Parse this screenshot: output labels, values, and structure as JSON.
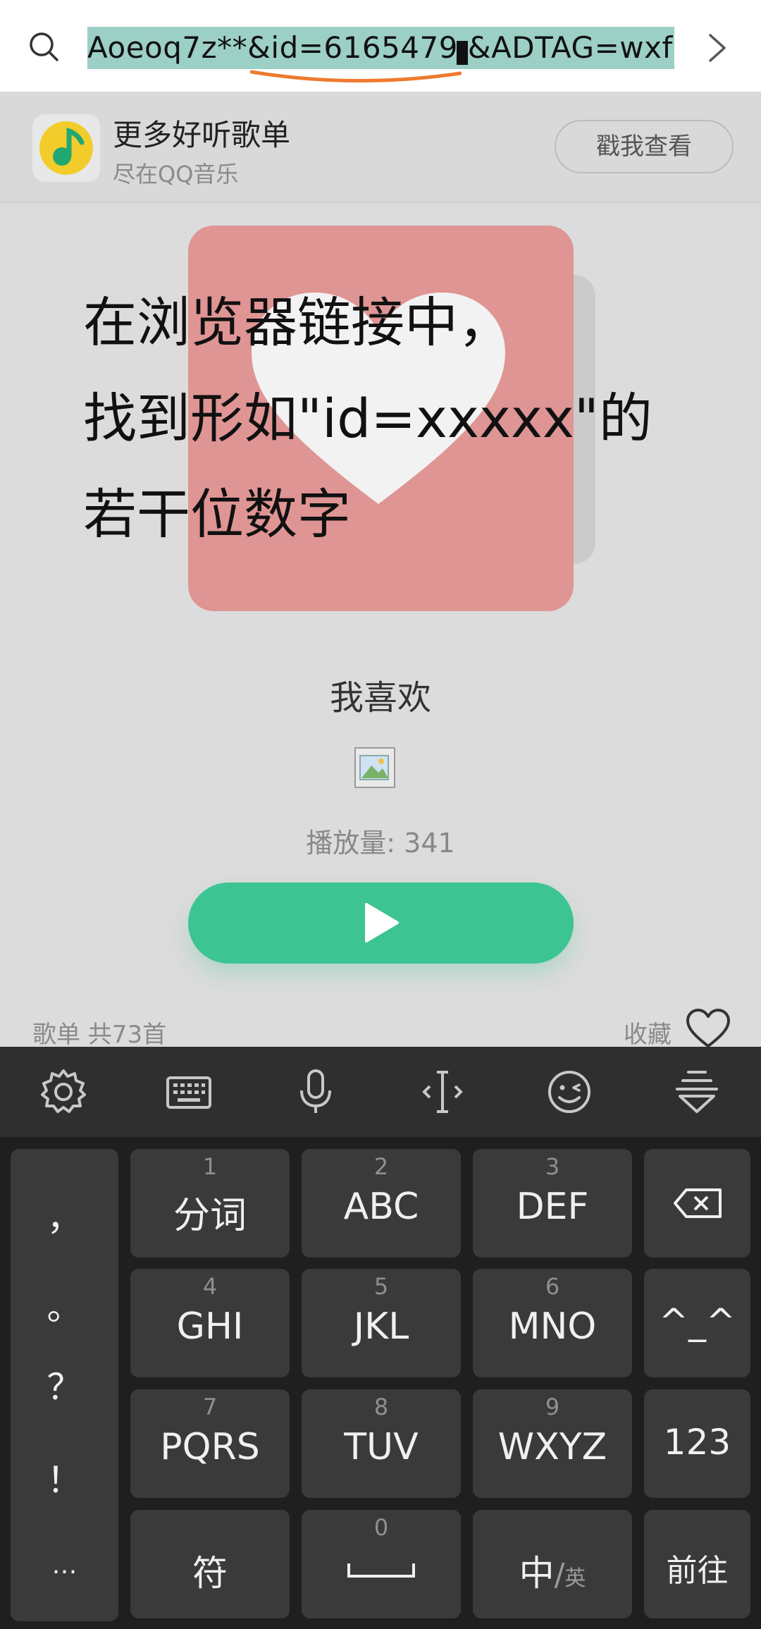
{
  "url_bar": {
    "url_text": "Aoeoq7z**&id=6165479  &ADTAG=wxf",
    "highlight_color": "#9ccfc6",
    "underline_color": "#ef7a2e"
  },
  "banner": {
    "title": "更多好听歌单",
    "subtitle": "尽在QQ音乐",
    "button_label": "戳我查看"
  },
  "overlay": {
    "lines": [
      "在浏览器链接中，",
      "找到形如\"id=xxxxx\"的",
      "若干位数字"
    ]
  },
  "playlist": {
    "title": "我喜欢",
    "play_count": "播放量: 341",
    "song_count": "歌单 共73首",
    "favorite_label": "收藏",
    "cover_color": "#df9594",
    "play_button_color": "#3cc493"
  },
  "keyboard": {
    "toolbar_icons": [
      "settings-icon",
      "keyboard-icon",
      "microphone-icon",
      "cursor-icon",
      "emoji-icon",
      "hide-keyboard-icon"
    ],
    "punctuation": [
      "，",
      "。",
      "？",
      "！",
      "…"
    ],
    "keys": {
      "k1": {
        "num": "1",
        "label": "分词"
      },
      "k2": {
        "num": "2",
        "label": "ABC"
      },
      "k3": {
        "num": "3",
        "label": "DEF"
      },
      "k4": {
        "num": "4",
        "label": "GHI"
      },
      "k5": {
        "num": "5",
        "label": "JKL"
      },
      "k6": {
        "num": "6",
        "label": "MNO"
      },
      "k7": {
        "num": "7",
        "label": "PQRS"
      },
      "k8": {
        "num": "8",
        "label": "TUV"
      },
      "k9": {
        "num": "9",
        "label": "WXYZ"
      },
      "k0": {
        "num": "0"
      },
      "emoticon": "^_^",
      "numbers": "123",
      "symbols": "符",
      "lang_main": "中",
      "lang_slash": "/",
      "lang_alt": "英",
      "go": "前往"
    }
  }
}
